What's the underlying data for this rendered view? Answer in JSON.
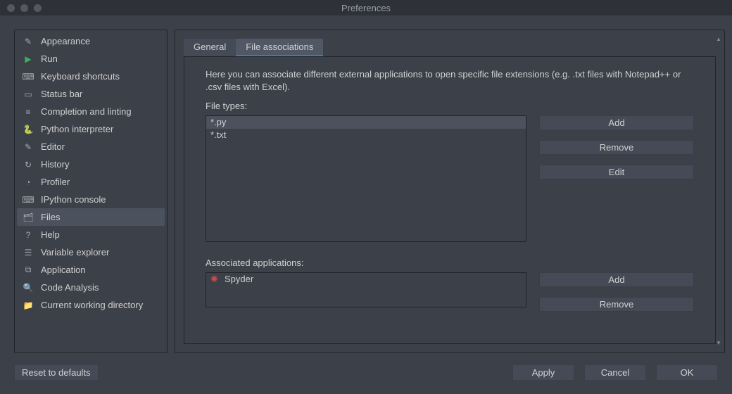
{
  "window": {
    "title": "Preferences"
  },
  "sidebar": {
    "items": [
      {
        "label": "Appearance",
        "icon": "✎"
      },
      {
        "label": "Run",
        "icon": "▶"
      },
      {
        "label": "Keyboard shortcuts",
        "icon": "⌨"
      },
      {
        "label": "Status bar",
        "icon": "▭"
      },
      {
        "label": "Completion and linting",
        "icon": "≡"
      },
      {
        "label": "Python interpreter",
        "icon": "🐍"
      },
      {
        "label": "Editor",
        "icon": "✎"
      },
      {
        "label": "History",
        "icon": "↻"
      },
      {
        "label": "Profiler",
        "icon": "◔"
      },
      {
        "label": "IPython console",
        "icon": "⌨"
      },
      {
        "label": "Files",
        "icon": "🗂"
      },
      {
        "label": "Help",
        "icon": "?"
      },
      {
        "label": "Variable explorer",
        "icon": "☰"
      },
      {
        "label": "Application",
        "icon": "⧉"
      },
      {
        "label": "Code Analysis",
        "icon": "🔍"
      },
      {
        "label": "Current working directory",
        "icon": "📁"
      }
    ],
    "selected_index": 10
  },
  "tabs": {
    "items": [
      "General",
      "File associations"
    ],
    "active_index": 1
  },
  "file_assoc": {
    "description": "Here you can associate different external applications to open specific file extensions (e.g. .txt files with Notepad++ or .csv files with Excel).",
    "file_types_label": "File types:",
    "file_types": [
      "*.py",
      "*.txt"
    ],
    "file_types_selected_index": 0,
    "assoc_apps_label": "Associated applications:",
    "assoc_apps": [
      {
        "name": "Spyder",
        "icon": "✺"
      }
    ],
    "buttons": {
      "add": "Add",
      "remove": "Remove",
      "edit": "Edit"
    }
  },
  "footer": {
    "reset": "Reset to defaults",
    "apply": "Apply",
    "cancel": "Cancel",
    "ok": "OK"
  }
}
